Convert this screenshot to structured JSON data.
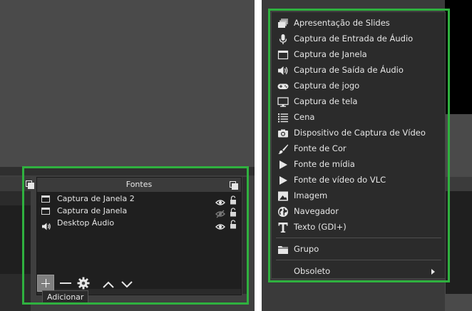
{
  "sources_dock": {
    "title": "Fontes",
    "items": [
      {
        "label": "Captura de Janela 2",
        "icon": "window-icon",
        "visible": true
      },
      {
        "label": "Captura de Janela",
        "icon": "window-icon",
        "visible": false
      },
      {
        "label": "Desktop Áudio",
        "icon": "speaker-icon",
        "visible": true
      }
    ]
  },
  "toolbar": {
    "add_tooltip": "Adicionar"
  },
  "add_source_menu": {
    "items": [
      {
        "label": "Apresentação de Slides",
        "icon": "slideshow-icon"
      },
      {
        "label": "Captura de Entrada de Áudio",
        "icon": "microphone-icon"
      },
      {
        "label": "Captura de Janela",
        "icon": "window-icon"
      },
      {
        "label": "Captura de Saída de Áudio",
        "icon": "speaker-icon"
      },
      {
        "label": "Captura de jogo",
        "icon": "gamepad-icon"
      },
      {
        "label": "Captura de tela",
        "icon": "monitor-icon"
      },
      {
        "label": "Cena",
        "icon": "list-icon"
      },
      {
        "label": "Dispositivo de Captura de Vídeo",
        "icon": "camera-icon"
      },
      {
        "label": "Fonte de Cor",
        "icon": "brush-icon"
      },
      {
        "label": "Fonte de mídia",
        "icon": "play-icon"
      },
      {
        "label": "Fonte de vídeo do VLC",
        "icon": "play-icon"
      },
      {
        "label": "Imagem",
        "icon": "image-icon"
      },
      {
        "label": "Navegador",
        "icon": "globe-icon"
      },
      {
        "label": "Texto (GDI+)",
        "icon": "text-icon"
      }
    ],
    "group_label": "Grupo",
    "deprecated_label": "Obsoleto"
  },
  "colors": {
    "highlight": "#2fb13f",
    "menu_bg": "#2b2b2b",
    "panel_bg": "#3a3a3a"
  }
}
